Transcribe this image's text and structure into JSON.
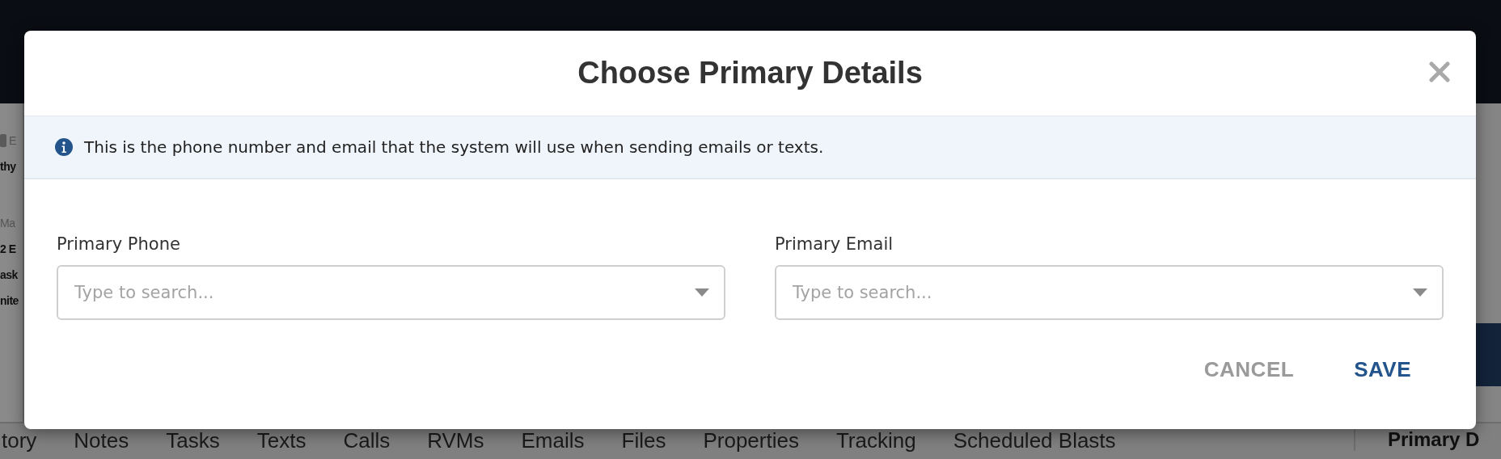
{
  "background": {
    "side_texts": [
      {
        "text": "E",
        "kind": "muted"
      },
      {
        "text": "thy",
        "kind": "bold"
      },
      {
        "text": "Ma",
        "kind": "muted"
      },
      {
        "text": "2 E",
        "kind": "bold"
      },
      {
        "text": "ask",
        "kind": "bold"
      },
      {
        "text": "nite",
        "kind": "bold"
      }
    ],
    "tabs": [
      "tory",
      "Notes",
      "Tasks",
      "Texts",
      "Calls",
      "RVMs",
      "Emails",
      "Files",
      "Properties",
      "Tracking",
      "Scheduled Blasts"
    ],
    "side_heading": "Primary D"
  },
  "dialog": {
    "title": "Choose Primary Details",
    "info": "This is the phone number and email that the system will use when sending emails or texts.",
    "fields": [
      {
        "label": "Primary Phone",
        "placeholder": "Type to search..."
      },
      {
        "label": "Primary Email",
        "placeholder": "Type to search..."
      }
    ],
    "buttons": [
      {
        "label": "CANCEL",
        "kind": "secondary"
      },
      {
        "label": "SAVE",
        "kind": "primary"
      }
    ]
  }
}
